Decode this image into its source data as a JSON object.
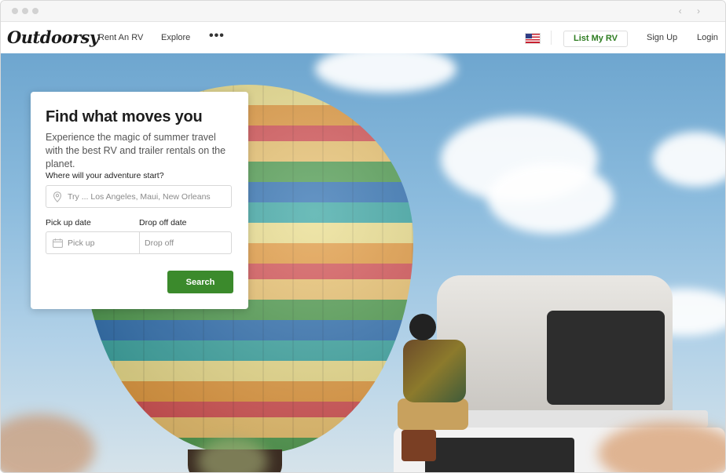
{
  "nav": {
    "logo": "Outdoorsy",
    "rent_label": "Rent An RV",
    "explore_label": "Explore",
    "more_label": "•••",
    "list_rv_label": "List My RV",
    "signup_label": "Sign Up",
    "login_label": "Login",
    "locale_flag": "us-flag-icon"
  },
  "chrome": {
    "arrows": "‹ ›"
  },
  "search": {
    "title": "Find what moves you",
    "subtitle": "Experience the magic of summer travel with the best RV and trailer rentals on the planet.",
    "where_label": "Where will your adventure start?",
    "where_placeholder": "Try ... Los Angeles, Maui, New Orleans",
    "pickup_label": "Pick up date",
    "pickup_placeholder": "Pick up",
    "dropoff_label": "Drop off date",
    "dropoff_placeholder": "Drop off",
    "button_label": "Search"
  },
  "colors": {
    "brand_green": "#3b8a2c",
    "list_rv_text": "#2f7d22"
  }
}
